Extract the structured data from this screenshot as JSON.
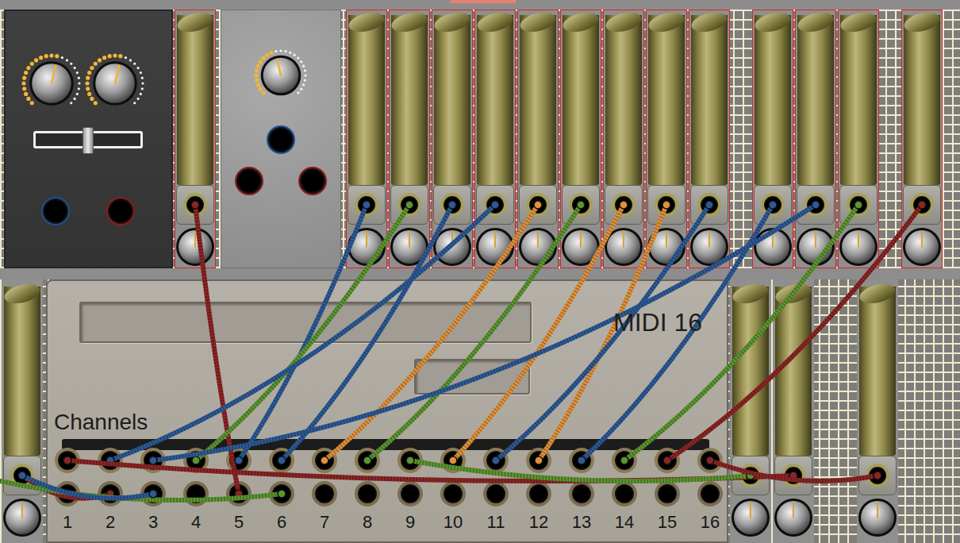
{
  "top_row": [
    {
      "kind": "mixer",
      "knobs": [
        {
          "level": 0.55
        },
        {
          "level": 0.55
        }
      ],
      "slider": {
        "level": 0.5
      },
      "jacks": [
        "in",
        "out"
      ]
    },
    {
      "kind": "tube",
      "knob": {
        "level": 0.5
      }
    },
    {
      "kind": "panel",
      "knobs": [
        {
          "level": 0.45
        }
      ],
      "jacks": [
        "in",
        "out",
        "out"
      ]
    },
    {
      "kind": "tube",
      "knob": {
        "level": 0.5
      }
    },
    {
      "kind": "tube",
      "knob": {
        "level": 0.5
      }
    },
    {
      "kind": "tube",
      "knob": {
        "level": 0.5
      }
    },
    {
      "kind": "tube",
      "knob": {
        "level": 0.5
      }
    },
    {
      "kind": "tube",
      "knob": {
        "level": 0.5
      }
    },
    {
      "kind": "tube",
      "knob": {
        "level": 0.5
      }
    },
    {
      "kind": "tube",
      "knob": {
        "level": 0.5
      }
    },
    {
      "kind": "tube",
      "knob": {
        "level": 0.5
      }
    },
    {
      "kind": "tube",
      "knob": {
        "level": 0.5
      }
    },
    {
      "kind": "empty"
    },
    {
      "kind": "tube",
      "knob": {
        "level": 0.5
      }
    },
    {
      "kind": "tube",
      "knob": {
        "level": 0.5
      }
    },
    {
      "kind": "tube",
      "knob": {
        "level": 0.5
      }
    },
    {
      "kind": "empty"
    },
    {
      "kind": "tube",
      "knob": {
        "level": 0.5
      }
    },
    {
      "kind": "empty"
    }
  ],
  "bottom_row": [
    {
      "kind": "tube",
      "knob": {
        "level": 0.5
      }
    },
    {
      "kind": "midi",
      "title": "MIDI 16",
      "label": "Channels",
      "channels": [
        "1",
        "2",
        "3",
        "4",
        "5",
        "6",
        "7",
        "8",
        "9",
        "10",
        "11",
        "12",
        "13",
        "14",
        "15",
        "16"
      ]
    },
    {
      "kind": "tube",
      "knob": {
        "level": 0.5
      }
    },
    {
      "kind": "tube",
      "knob": {
        "level": 0.5
      }
    },
    {
      "kind": "empty"
    },
    {
      "kind": "empty"
    },
    {
      "kind": "tube",
      "knob": {
        "level": 0.5
      }
    },
    {
      "kind": "empty"
    }
  ],
  "cables": [
    {
      "color": "#8c2525",
      "from": "top:1",
      "to": "midi:5:b"
    },
    {
      "color": "#2d5a96",
      "from": "top:3",
      "to": "midi:5:a"
    },
    {
      "color": "#5b9630",
      "from": "top:4",
      "to": "midi:4:a"
    },
    {
      "color": "#2d5a96",
      "from": "top:5",
      "to": "midi:6:a"
    },
    {
      "color": "#2d5a96",
      "from": "top:6",
      "to": "midi:2:a"
    },
    {
      "color": "#e0913a",
      "from": "top:7",
      "to": "midi:7:a"
    },
    {
      "color": "#5b9630",
      "from": "top:8",
      "to": "midi:8:a"
    },
    {
      "color": "#e0913a",
      "from": "top:9",
      "to": "midi:10:a"
    },
    {
      "color": "#e0913a",
      "from": "top:10",
      "to": "midi:12:a"
    },
    {
      "color": "#2d5a96",
      "from": "top:11",
      "to": "midi:11:a"
    },
    {
      "color": "#2d5a96",
      "from": "top:13",
      "to": "midi:13:a"
    },
    {
      "color": "#2d5a96",
      "from": "top:14",
      "to": "midi:3:a"
    },
    {
      "color": "#5b9630",
      "from": "top:15",
      "to": "midi:14:a"
    },
    {
      "color": "#8c2525",
      "from": "top:17",
      "to": "midi:15:a"
    },
    {
      "color": "#8c2525",
      "from": "midi:1:a",
      "to": "bottom:3"
    },
    {
      "color": "#5b9630",
      "from": "midi:9:a",
      "to": "bottom:2"
    },
    {
      "color": "#8c2525",
      "from": "midi:16:a",
      "to": "bottom:6"
    },
    {
      "color": "#8c2525",
      "from": "midi:2:b",
      "to": "bottom:0"
    },
    {
      "color": "#5b9630",
      "from": "edge:left",
      "to": "midi:6:b"
    },
    {
      "color": "#2d5a96",
      "from": "midi:3:b",
      "to": "bottom:0"
    }
  ]
}
